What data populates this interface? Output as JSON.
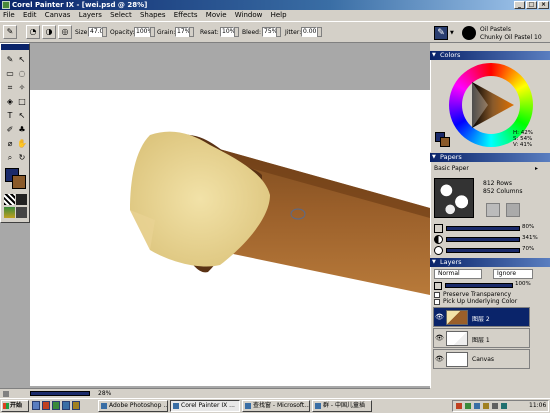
{
  "window": {
    "title": "Corel Painter IX - [wei.psd @ 28%]",
    "controls": [
      "_",
      "□",
      "×"
    ]
  },
  "menu": [
    "File",
    "Edit",
    "Canvas",
    "Layers",
    "Select",
    "Shapes",
    "Effects",
    "Movie",
    "Window",
    "Help"
  ],
  "property_bar": {
    "size_label": "Size:",
    "size_value": "47.0",
    "opacity_label": "Opacity:",
    "opacity_value": "100%",
    "grain_label": "Grain:",
    "grain_value": "17%",
    "resat_label": "Resat:",
    "resat_value": "10%",
    "bleed_label": "Bleed:",
    "bleed_value": "75%",
    "jitter_label": "Jitter:",
    "jitter_value": "0.00"
  },
  "brush_selector": {
    "category": "Oil Pastels",
    "variant": "Chunky Oil Pastel 10"
  },
  "colors_panel": {
    "title": "Colors",
    "hue": "H: 42%",
    "saturation": "S: 54%",
    "value": "V: 41%",
    "main_color": "#8a5a2a",
    "secondary_color": "#1a2a6a"
  },
  "papers_panel": {
    "title": "Papers",
    "paper_name": "Basic Paper",
    "rows": "812 Rows",
    "columns": "852 Columns",
    "slider1": "80%",
    "slider2": "341%",
    "slider3": "70%"
  },
  "layers_panel": {
    "title": "Layers",
    "composite_method": "Normal",
    "composite_depth": "Ignore",
    "opacity": "100%",
    "preserve_transparency": "Preserve Transparency",
    "pick_up_color": "Pick Up Underlying Color",
    "layers": [
      {
        "name": "图层 2",
        "selected": true
      },
      {
        "name": "图层 1",
        "selected": false
      },
      {
        "name": "Canvas",
        "selected": false
      }
    ]
  },
  "status_bar": {
    "zoom": "28%"
  },
  "taskbar": {
    "start": "开始",
    "tasks": [
      {
        "label": "Adobe Photoshop ...",
        "active": false
      },
      {
        "label": "Corel Painter IX ...",
        "active": true
      },
      {
        "label": "查找窗 - Microsoft...",
        "active": false
      },
      {
        "label": "群 - 中国儿童插",
        "active": false
      }
    ],
    "clock": "11:06"
  }
}
